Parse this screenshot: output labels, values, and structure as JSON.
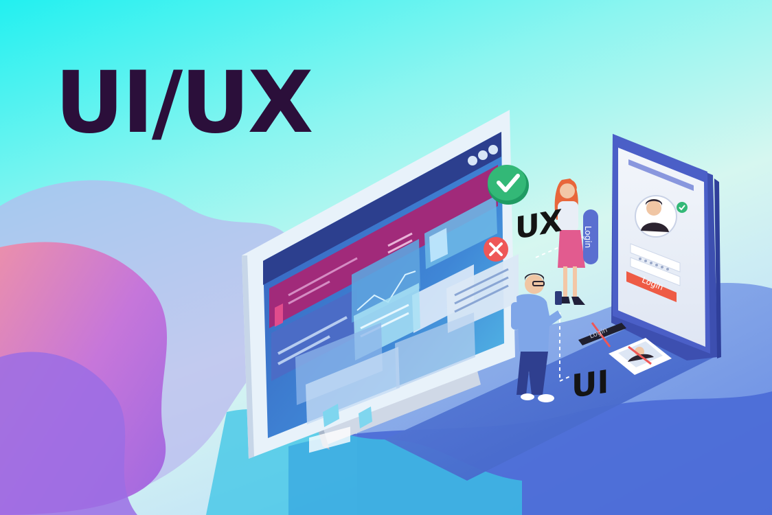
{
  "headline": "UI/UX",
  "labels": {
    "ux": "UX",
    "ui": "UI",
    "phone_login_button": "Login",
    "woman_login_sign": "Login",
    "dark_login_button": "Login"
  },
  "icons": {
    "check": "check-icon",
    "cross": "close-icon",
    "phone_check": "check-icon"
  },
  "colors": {
    "headline": "#2b0f3a",
    "monitor_frame": "#e8f2fa",
    "screen_blue": "#3a5fbe",
    "screen_magenta": "#a12a7a",
    "check_green": "#1f9b63",
    "cross_red": "#ee5757",
    "login_orange": "#ee5b45",
    "phone_body": "#4b5fc7"
  }
}
